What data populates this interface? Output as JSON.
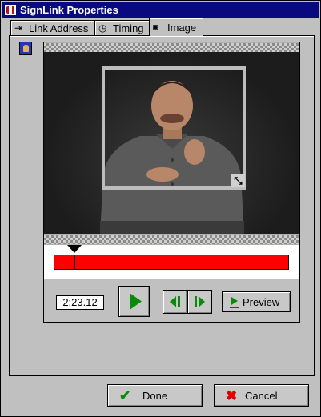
{
  "window": {
    "title": "SignLink Properties"
  },
  "tabs": [
    {
      "label": "Link Address",
      "icon": "link-icon"
    },
    {
      "label": "Timing",
      "icon": "clock-icon"
    },
    {
      "label": "Image",
      "icon": "camera-icon",
      "active": true
    }
  ],
  "player": {
    "timecode": "2:23.12",
    "playhead_position_fraction": 0.09,
    "preview_label": "Preview"
  },
  "colors": {
    "titlebar": "#0a0a80",
    "timeline_bar": "#ff0000",
    "play_green": "#0a8a0a",
    "cancel_red": "#e00000"
  },
  "buttons": {
    "done": "Done",
    "cancel": "Cancel"
  }
}
